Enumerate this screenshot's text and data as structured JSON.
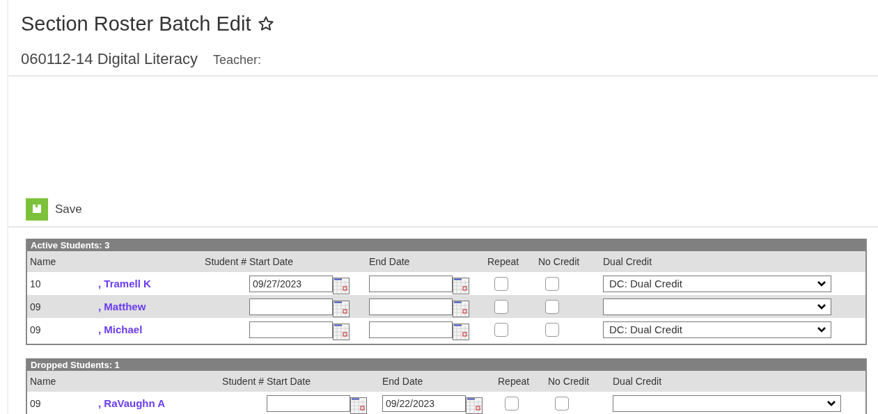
{
  "page": {
    "title": "Section Roster Batch Edit",
    "subtitle": "060112-14 Digital Literacy",
    "teacher_label": "Teacher:"
  },
  "toolbar": {
    "save_label": "Save"
  },
  "sections": [
    {
      "title": "Active Students: 3",
      "columns": [
        "Name",
        "Student #",
        "Start Date",
        "End Date",
        "Repeat",
        "No Credit",
        "Dual Credit"
      ],
      "rows": [
        {
          "grade": "10",
          "name": ", Tramell K",
          "start_date": "09/27/2023",
          "repeat": false,
          "no_credit": false,
          "dual_credit": "DC: Dual Credit"
        },
        {
          "grade": "09",
          "name": ", Matthew",
          "repeat": false,
          "no_credit": false
        },
        {
          "grade": "09",
          "name": ", Michael",
          "repeat": false,
          "no_credit": false,
          "dual_credit": "DC: Dual Credit"
        }
      ]
    },
    {
      "title": "Dropped Students: 1",
      "columns": [
        "Name",
        "Student #",
        "Start Date",
        "End Date",
        "Repeat",
        "No Credit",
        "Dual Credit"
      ],
      "rows": [
        {
          "grade": "09",
          "name": ", RaVaughn A",
          "end_date": "09/22/2023",
          "repeat": false,
          "no_credit": false
        }
      ]
    }
  ]
}
